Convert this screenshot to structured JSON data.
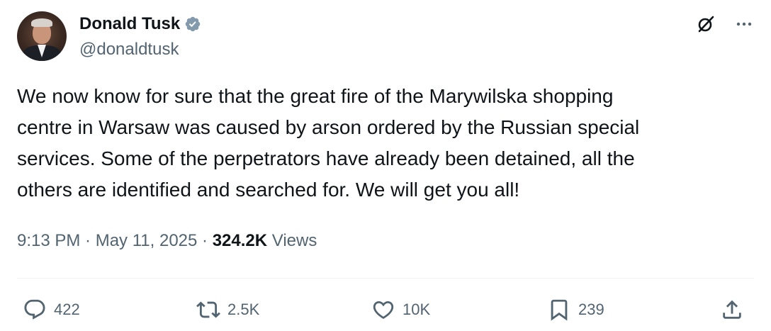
{
  "author": {
    "display_name": "Donald Tusk",
    "handle": "@donaldtusk",
    "verified": true
  },
  "tweet": {
    "text": "We now know for sure that the great fire of the Marywilska shopping\ncentre in Warsaw was caused by arson ordered  by the Russian special\nservices. Some of the perpetrators have already been detained, all the\nothers are identified and searched for. We will get you all!"
  },
  "meta": {
    "time": "9:13 PM",
    "separator": " · ",
    "date": "May 11, 2025",
    "views_count": "324.2K",
    "views_label": " Views"
  },
  "actions": {
    "reply_count": "422",
    "retweet_count": "2.5K",
    "like_count": "10K",
    "bookmark_count": "239"
  },
  "icons": {
    "verified": "verified-badge-icon",
    "top_right": [
      "grok-icon",
      "more-icon"
    ],
    "action_bar": [
      "reply-icon",
      "retweet-icon",
      "like-icon",
      "bookmark-icon",
      "share-icon"
    ]
  },
  "colors": {
    "text_primary": "#0f1419",
    "text_secondary": "#536471",
    "verified_badge": "#829aab",
    "divider": "#eff3f4"
  }
}
